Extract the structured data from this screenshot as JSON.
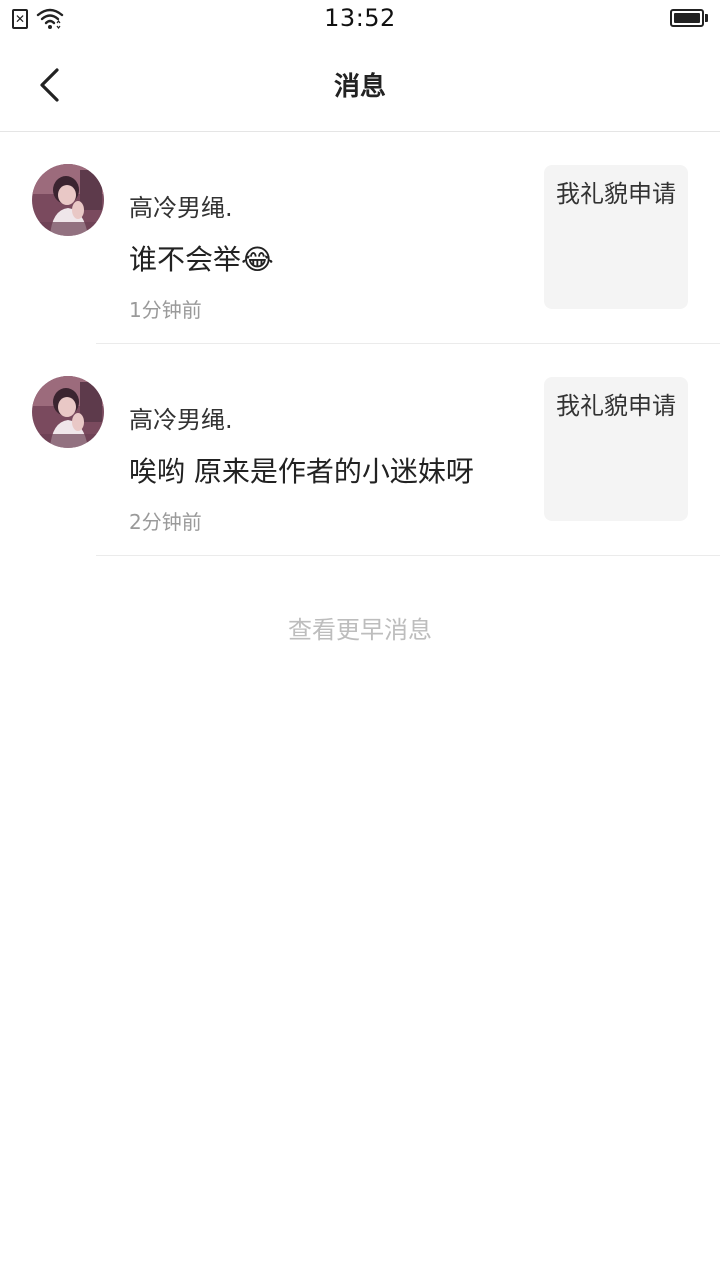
{
  "status_bar": {
    "time": "13:52",
    "icons": [
      "sim-card-icon",
      "wifi-icon",
      "battery-icon"
    ]
  },
  "nav": {
    "title": "消息",
    "back_icon": "chevron-left-icon"
  },
  "messages": [
    {
      "user": "高冷男绳.",
      "text": "谁不会举😂",
      "time": "1分钟前",
      "ref_text": "我礼貌申请"
    },
    {
      "user": "高冷男绳.",
      "text": "唉哟 原来是作者的小迷妹呀",
      "time": "2分钟前",
      "ref_text": "我礼貌申请"
    }
  ],
  "footer": {
    "earlier_label": "查看更早消息"
  },
  "colors": {
    "divider": "#e5e5e5",
    "ref_card_bg": "#f4f4f4",
    "muted_text": "#9a9a9a",
    "link_text": "#bdbdbd"
  }
}
